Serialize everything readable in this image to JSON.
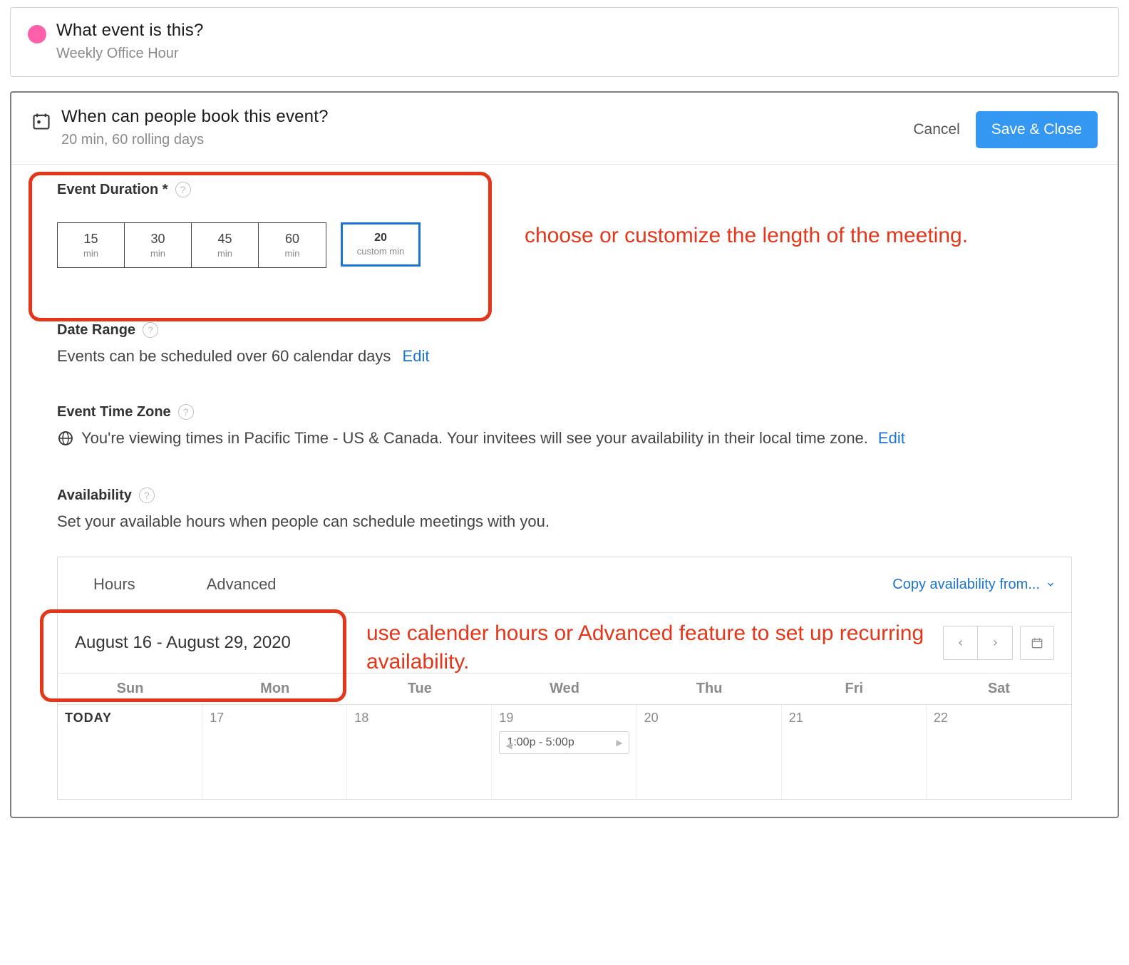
{
  "top_card": {
    "question": "What event is this?",
    "answer": "Weekly Office Hour"
  },
  "header": {
    "question": "When can people book this event?",
    "summary": "20 min, 60 rolling days",
    "cancel": "Cancel",
    "save": "Save & Close"
  },
  "duration": {
    "label": "Event Duration *",
    "options": [
      {
        "value": "15",
        "unit": "min"
      },
      {
        "value": "30",
        "unit": "min"
      },
      {
        "value": "45",
        "unit": "min"
      },
      {
        "value": "60",
        "unit": "min"
      }
    ],
    "custom": {
      "value": "20",
      "unit": "custom min"
    }
  },
  "date_range": {
    "label": "Date Range",
    "text": "Events can be scheduled over 60 calendar days",
    "edit": "Edit"
  },
  "timezone": {
    "label": "Event Time Zone",
    "text": "You're viewing times in Pacific Time - US & Canada. Your invitees will see your availability in their local time zone.",
    "edit": "Edit"
  },
  "availability": {
    "label": "Availability",
    "text": "Set your available hours when people can schedule meetings with you.",
    "tabs": {
      "hours": "Hours",
      "advanced": "Advanced"
    },
    "copy": "Copy availability from...",
    "range": "August 16 - August 29, 2020",
    "weekdays": [
      "Sun",
      "Mon",
      "Tue",
      "Wed",
      "Thu",
      "Fri",
      "Sat"
    ],
    "days": [
      {
        "label": "TODAY",
        "is_today": true
      },
      {
        "label": "17"
      },
      {
        "label": "18"
      },
      {
        "label": "19",
        "slot": "1:00p - 5:00p"
      },
      {
        "label": "20"
      },
      {
        "label": "21"
      },
      {
        "label": "22"
      }
    ]
  },
  "annotations": {
    "a1": "choose or customize the length of the meeting.",
    "a2": "use calender hours or Advanced feature to set up recurring availability."
  }
}
